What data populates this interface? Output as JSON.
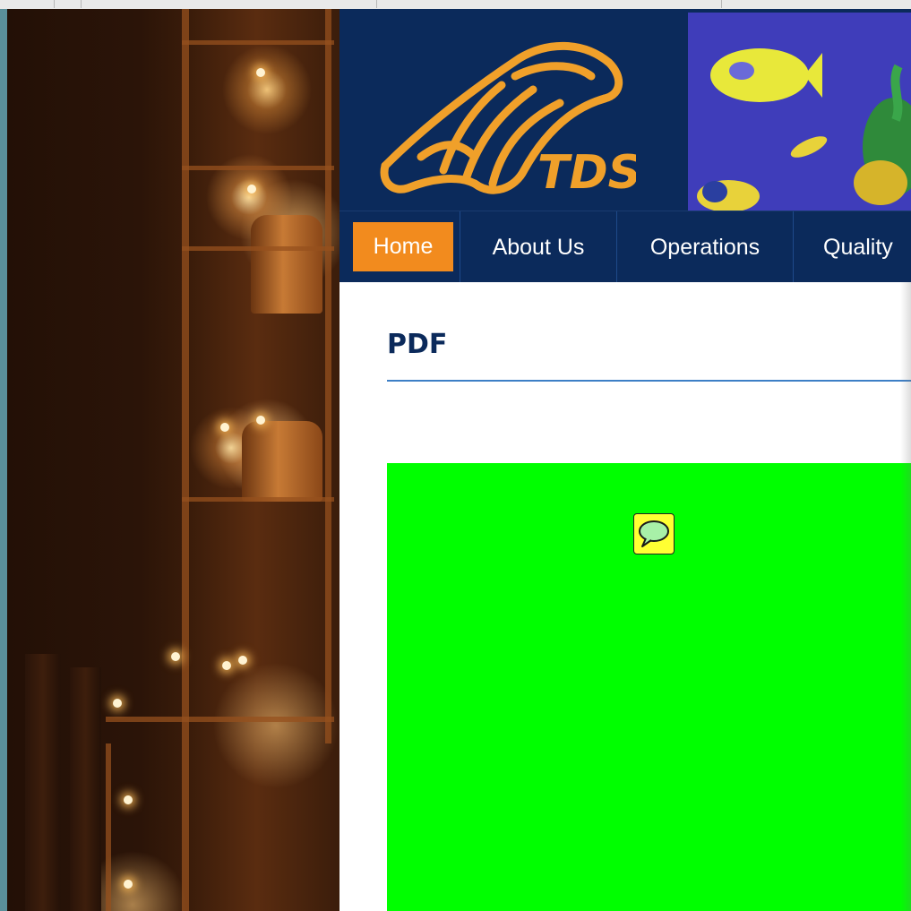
{
  "logo": {
    "text": "TDS",
    "color": "#f0a02a"
  },
  "nav": {
    "items": [
      {
        "label": "Home"
      },
      {
        "label": "About Us"
      },
      {
        "label": "Operations"
      },
      {
        "label": "Quality"
      }
    ],
    "active_color": "#f28b1e",
    "background": "#0b2a5b"
  },
  "content": {
    "title": "PDF"
  },
  "pdf_viewer": {
    "background": "#00ff00",
    "annotation_icon": "speech-bubble-icon"
  }
}
